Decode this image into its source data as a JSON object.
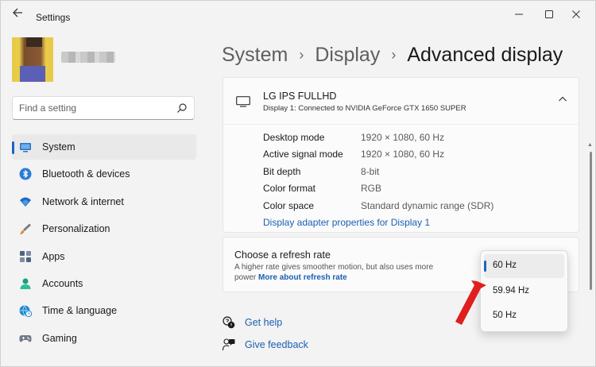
{
  "window": {
    "title": "Settings",
    "back_icon": "back-arrow-icon",
    "controls": {
      "minimize": "—",
      "maximize": "☐",
      "close": "✕"
    }
  },
  "sidebar": {
    "search_placeholder": "Find a setting",
    "items": [
      {
        "label": "System",
        "icon": "system-icon",
        "color": "#2b73c6",
        "active": true
      },
      {
        "label": "Bluetooth & devices",
        "icon": "bluetooth-icon",
        "color": "#2a7cd6",
        "active": false
      },
      {
        "label": "Network & internet",
        "icon": "wifi-icon",
        "color": "#1b6cc5",
        "active": false
      },
      {
        "label": "Personalization",
        "icon": "brush-icon",
        "color": "#d58a3d",
        "active": false
      },
      {
        "label": "Apps",
        "icon": "apps-icon",
        "color": "#50637c",
        "active": false
      },
      {
        "label": "Accounts",
        "icon": "accounts-icon",
        "color": "#17a07a",
        "active": false
      },
      {
        "label": "Time & language",
        "icon": "globe-clock-icon",
        "color": "#1f88d0",
        "active": false
      },
      {
        "label": "Gaming",
        "icon": "gamepad-icon",
        "color": "#6f7b87",
        "active": false
      }
    ]
  },
  "breadcrumb": {
    "items": [
      "System",
      "Display"
    ],
    "separator": "›",
    "current": "Advanced display"
  },
  "display_card": {
    "name": "LG IPS FULLHD",
    "subtitle": "Display 1: Connected to NVIDIA GeForce GTX 1650 SUPER",
    "rows": [
      {
        "label": "Desktop mode",
        "value": "1920 × 1080, 60 Hz"
      },
      {
        "label": "Active signal mode",
        "value": "1920 × 1080, 60 Hz"
      },
      {
        "label": "Bit depth",
        "value": "8-bit"
      },
      {
        "label": "Color format",
        "value": "RGB"
      },
      {
        "label": "Color space",
        "value": "Standard dynamic range (SDR)"
      }
    ],
    "adapter_link": "Display adapter properties for Display 1"
  },
  "refresh_card": {
    "title": "Choose a refresh rate",
    "description_line1": "A higher rate gives smoother motion, but also uses more",
    "description_line2": "power",
    "link": "More about refresh rate"
  },
  "refresh_dropdown": {
    "options": [
      "60 Hz",
      "59.94 Hz",
      "50 Hz"
    ],
    "selected": "60 Hz"
  },
  "help": {
    "get_help": "Get help",
    "give_feedback": "Give feedback"
  },
  "colors": {
    "accent": "#1d64c1",
    "link": "#1b5fb3",
    "arrow": "#e01e1e"
  }
}
